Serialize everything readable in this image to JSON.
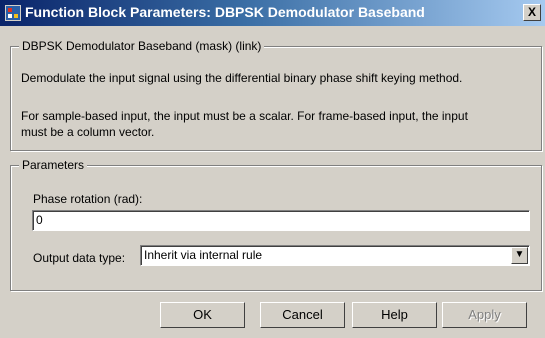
{
  "window": {
    "title": "Function Block Parameters: DBPSK Demodulator Baseband",
    "close_label": "X"
  },
  "mask_group": {
    "legend": "DBPSK Demodulator Baseband (mask) (link)",
    "description_line1": "Demodulate the input signal using the differential binary phase shift keying method.",
    "description_line2a": "For sample-based input, the input must be a scalar. For frame-based input, the input",
    "description_line2b": "must be a column vector."
  },
  "parameters_group": {
    "legend": "Parameters",
    "phase_label": "Phase rotation (rad):",
    "phase_value": "0",
    "output_type_label": "Output data type:",
    "output_type_value": "Inherit via internal rule"
  },
  "buttons": {
    "ok": "OK",
    "cancel": "Cancel",
    "help": "Help",
    "apply": "Apply"
  }
}
